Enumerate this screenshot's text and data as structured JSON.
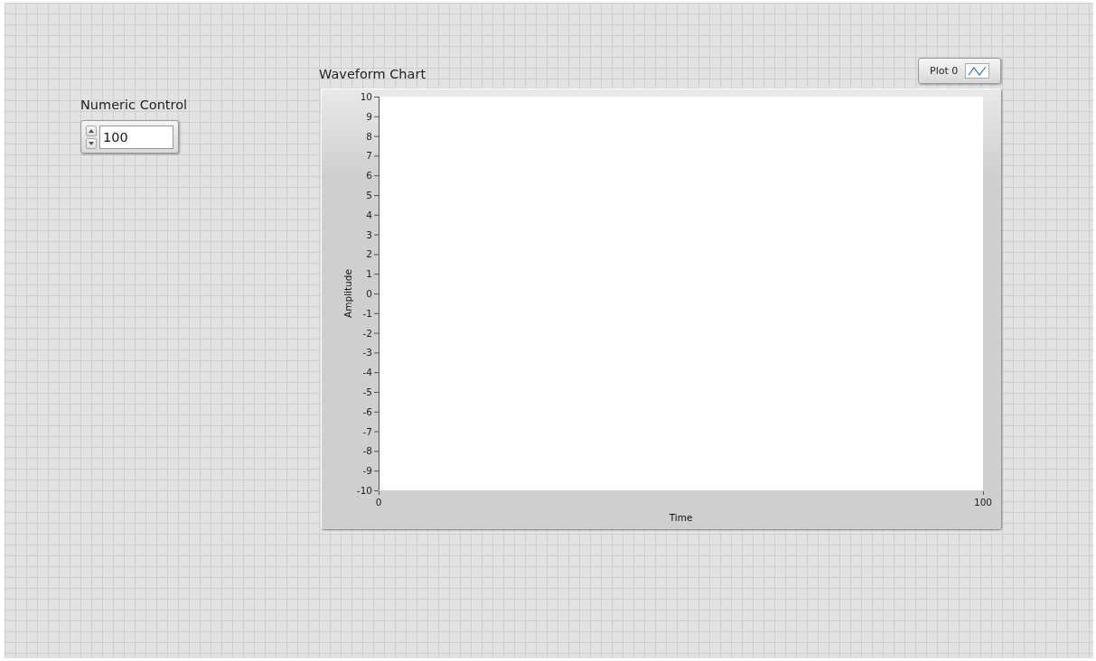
{
  "numeric_control": {
    "label": "Numeric Control",
    "value": "100"
  },
  "waveform_chart": {
    "legend": {
      "plot_name": "Plot 0"
    },
    "chart_data": {
      "type": "line",
      "title": "Waveform Chart",
      "xlabel": "Time",
      "ylabel": "Amplitude",
      "xlim": [
        0,
        100
      ],
      "ylim": [
        -10,
        10
      ],
      "xticks": [
        0,
        100
      ],
      "yticks": [
        10,
        9,
        8,
        7,
        6,
        5,
        4,
        3,
        2,
        1,
        0,
        -1,
        -2,
        -3,
        -4,
        -5,
        -6,
        -7,
        -8,
        -9,
        -10
      ]
    }
  }
}
